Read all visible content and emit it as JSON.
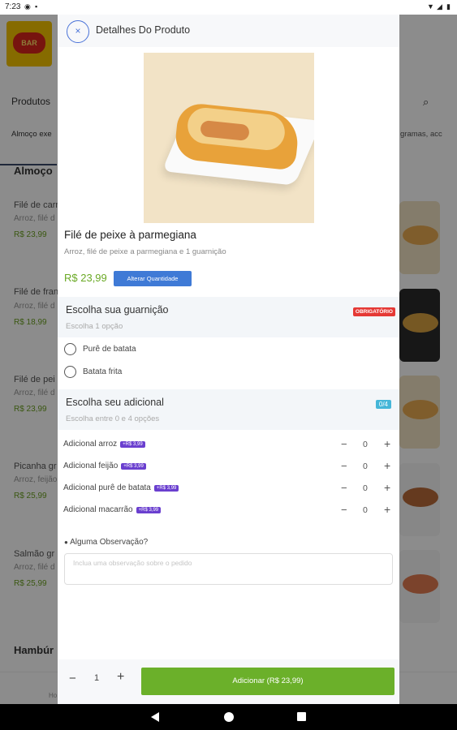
{
  "status_bar": {
    "time": "7:23"
  },
  "background": {
    "header_label": "Produtos",
    "tab_active": "Almoço exe",
    "tab_right": "gramas, acc",
    "section_almoco": "Almoço",
    "section_hamburguer": "Hambúr",
    "nav_home_label": "Ho",
    "items": [
      {
        "name": "Filé de carn",
        "desc": "Arroz, filé d",
        "price": "R$ 23,99"
      },
      {
        "name": "Filé de fran",
        "desc": "Arroz, filé d",
        "price": "R$ 18,99"
      },
      {
        "name": "Filé de pei",
        "desc": "Arroz, filé d",
        "price": "R$ 23,99"
      },
      {
        "name": "Picanha gr",
        "desc": "Arroz, feijão",
        "price": "R$ 25,99"
      },
      {
        "name": "Salmão gr",
        "desc": "Arroz, filé d",
        "price": "R$ 25,99"
      }
    ]
  },
  "modal": {
    "title": "Detalhes Do Produto",
    "product": {
      "name": "Filé de peixe à parmegiana",
      "description": "Arroz, filé de peixe a parmegiana e 1 guarnição",
      "price": "R$ 23,99",
      "change_qty_label": "Alterar Quantidade"
    },
    "garnish": {
      "title": "Escolha sua guarnição",
      "subtitle": "Escolha 1 opção",
      "badge": "OBRIGATÓRIO",
      "options": [
        "Purê de batata",
        "Batata frita"
      ]
    },
    "addons": {
      "title": "Escolha seu adicional",
      "subtitle": "Escolha entre 0 e 4 opções",
      "badge": "0/4",
      "items": [
        {
          "label": "Adicional arroz",
          "price": "+R$ 3,99",
          "qty": "0"
        },
        {
          "label": "Adicional feijão",
          "price": "+R$ 3,99",
          "qty": "0"
        },
        {
          "label": "Adicional purê de batata",
          "price": "+R$ 3,99",
          "qty": "0"
        },
        {
          "label": "Adicional macarrão",
          "price": "+R$ 3,99",
          "qty": "0"
        }
      ]
    },
    "observation": {
      "label": "Alguma Observação?",
      "placeholder": "Inclua uma observação sobre o pedido"
    },
    "footer": {
      "minus": "−",
      "qty": "1",
      "plus": "+",
      "add_label": "Adicionar (R$ 23,99)"
    }
  },
  "icons": {
    "stepper_minus": "−",
    "stepper_plus": "+",
    "close": "×",
    "search": "⌕",
    "comment": "💬"
  }
}
